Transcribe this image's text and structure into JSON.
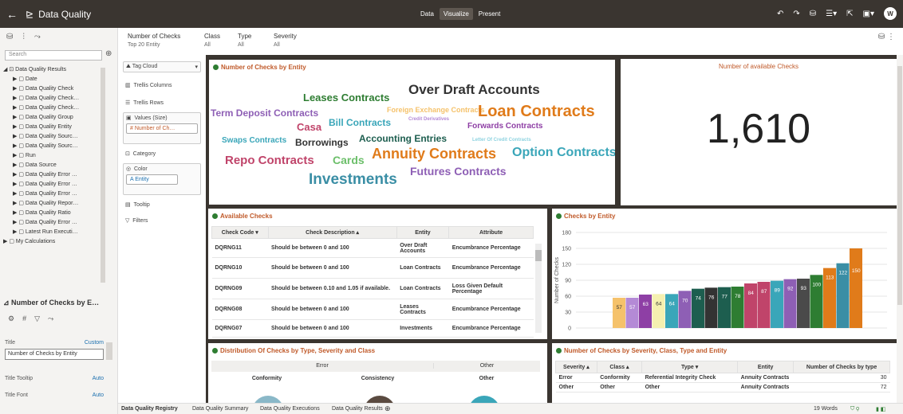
{
  "app": {
    "title": "Data Quality",
    "modes": [
      "Data",
      "Visualize",
      "Present"
    ],
    "active_mode": "Visualize",
    "avatar": "W"
  },
  "left_panel": {
    "search_placeholder": "Search",
    "tree_root": "Data Quality Results",
    "tree_items": [
      "Date",
      "Data Quality Check",
      "Data Quality Check…",
      "Data Quality Check…",
      "Data Quality Group",
      "Data Quality Entity",
      "Data Quality Sourc…",
      "Data Quality Sourc…",
      "Run",
      "Data Source",
      "Data Quality Error …",
      "Data Quality Error …",
      "Data Quality Error …",
      "Data Quality Repor…",
      "Data Quality Ratio",
      "Data Quality Error …",
      "Latest Run Executi…"
    ],
    "calc": "My Calculations",
    "viz_title": "Number of Checks by E…",
    "props": {
      "title_label": "Title",
      "title_value": "Custom",
      "title_input": "Number of Checks by Entity",
      "tooltip_label": "Title Tooltip",
      "tooltip_value": "Auto",
      "font_label": "Title Font",
      "font_value": "Auto"
    }
  },
  "filters": {
    "f1_label": "Number of Checks",
    "f1_value": "Top 20 Entity",
    "f2_label": "Class",
    "f2_value": "All",
    "f3_label": "Type",
    "f3_value": "All",
    "f4_label": "Severity",
    "f4_value": "All"
  },
  "grammar": {
    "viz_type": "Tag Cloud",
    "trellis_cols": "Trellis Columns",
    "trellis_rows": "Trellis Rows",
    "values": "Values (Size)",
    "values_chip": "# Number of Ch…",
    "category": "Category",
    "color": "Color",
    "color_chip": "A  Entity",
    "tooltip": "Tooltip",
    "filters": "Filters"
  },
  "tiles": {
    "cloud_title": "Number of Checks by Entity",
    "kpi_title": "Number of available Checks",
    "kpi_value": "1,610",
    "checks_title": "Available Checks",
    "bar_title": "Checks by Entity",
    "dist_title": "Distribution Of Checks by Type, Severity and Class",
    "sev_title": "Number of Checks by Severity, Class, Type and Entity"
  },
  "cloud_words": [
    {
      "t": "Over Draft Accounts",
      "c": "#333333"
    },
    {
      "t": "Leases Contracts",
      "c": "#2e7d32"
    },
    {
      "t": "Foreign Exchange Contracts",
      "c": "#f5c26b"
    },
    {
      "t": "Loan Contracts",
      "c": "#e07b1a"
    },
    {
      "t": "Term Deposit Contracts",
      "c": "#8e5fb5"
    },
    {
      "t": "Casa",
      "c": "#c0446a"
    },
    {
      "t": "Bill Contracts",
      "c": "#3aa6b9"
    },
    {
      "t": "Credit Derivatives",
      "c": "#b48ad6"
    },
    {
      "t": "Forwards Contracts",
      "c": "#8e3fa5"
    },
    {
      "t": "Swaps Contracts",
      "c": "#3aa6b9"
    },
    {
      "t": "Borrowings",
      "c": "#333333"
    },
    {
      "t": "Accounting Entries",
      "c": "#1d5e4f"
    },
    {
      "t": "Letter Of Credit Contracts",
      "c": "#8fd3e0"
    },
    {
      "t": "Repo Contracts",
      "c": "#c0446a"
    },
    {
      "t": "Cards",
      "c": "#6cbf6a"
    },
    {
      "t": "Annuity Contracts",
      "c": "#e07b1a"
    },
    {
      "t": "Option Contracts",
      "c": "#3aa6b9"
    },
    {
      "t": "Futures Contracts",
      "c": "#8e5fb5"
    },
    {
      "t": "Investments",
      "c": "#3a8ea5"
    }
  ],
  "checks_table": {
    "headers": [
      "Check Code",
      "Check Description",
      "Entity",
      "Attribute"
    ],
    "rows": [
      [
        "DQRNG11",
        "Should be between 0 and 100",
        "Over Draft Accounts",
        "Encumbrance Percentage"
      ],
      [
        "DQRNG10",
        "Should be between 0 and 100",
        "Loan Contracts",
        "Encumbrance Percentage"
      ],
      [
        "DQRNG09",
        "Should be between 0.10 and 1.05 if available.",
        "Loan Contracts",
        "Loss Given Default Percentage"
      ],
      [
        "DQRNG08",
        "Should be between 0 and 100",
        "Leases Contracts",
        "Encumbrance Percentage"
      ],
      [
        "DQRNG07",
        "Should be between 0 and 100",
        "Investments",
        "Encumbrance Percentage"
      ]
    ]
  },
  "chart_data": {
    "type": "bar",
    "title": "Checks by Entity",
    "ylabel": "Number of Checks",
    "ylim": [
      0,
      180
    ],
    "yticks": [
      0,
      30,
      60,
      90,
      120,
      150,
      180
    ],
    "values": [
      57,
      57,
      63,
      64,
      64,
      70,
      74,
      76,
      77,
      78,
      84,
      87,
      89,
      92,
      93,
      100,
      113,
      122,
      150
    ],
    "colors": [
      "#f5c26b",
      "#b48ad6",
      "#8e3fa5",
      "#f5f0b0",
      "#3aa6b9",
      "#8e5fb5",
      "#1d5e4f",
      "#333333",
      "#1d5e4f",
      "#2e7d32",
      "#c0446a",
      "#c0446a",
      "#3aa6b9",
      "#8e5fb5",
      "#4a4a4a",
      "#2e7d32",
      "#e07b1a",
      "#3a8ea5",
      "#e07b1a"
    ],
    "grid": true
  },
  "dist": {
    "group1": "Error",
    "group2": "Other",
    "c1": "Conformity",
    "c2": "Consistency",
    "c3": "Other"
  },
  "sev_table": {
    "headers": [
      "Severity",
      "Class",
      "Type",
      "Entity",
      "Number of Checks by type"
    ],
    "rows": [
      [
        "Error",
        "Conformity",
        "Referential Integrity Check",
        "Annuity Contracts",
        "30"
      ],
      [
        "Other",
        "Other",
        "Other",
        "Annuity Contracts",
        "72"
      ]
    ]
  },
  "bottom": {
    "tabs": [
      "Data Quality Registry",
      "Data Quality Summary",
      "Data Quality Executions",
      "Data Quality Results"
    ],
    "word_count": "19 Words"
  }
}
